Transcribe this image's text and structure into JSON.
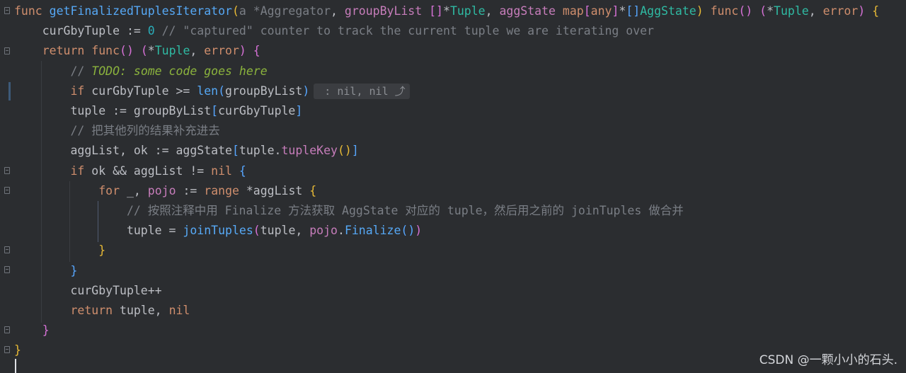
{
  "watermark": "CSDN @一颗小小的石头.",
  "lines": [
    [
      [
        "kw",
        "func "
      ],
      [
        "fn",
        "getFinalizedTuplesIterator"
      ],
      [
        "p1",
        "("
      ],
      [
        "cmt",
        "a *Aggregator"
      ],
      [
        "var",
        ", "
      ],
      [
        "param",
        "groupByList"
      ],
      [
        "var",
        " "
      ],
      [
        "p2",
        "[]"
      ],
      [
        "var",
        "*"
      ],
      [
        "type",
        "Tuple"
      ],
      [
        "var",
        ", "
      ],
      [
        "param",
        "aggState"
      ],
      [
        "var",
        " "
      ],
      [
        "kw",
        "map"
      ],
      [
        "p2",
        "["
      ],
      [
        "kw",
        "any"
      ],
      [
        "p2",
        "]"
      ],
      [
        "var",
        "*"
      ],
      [
        "p3",
        "[]"
      ],
      [
        "type",
        "AggState"
      ],
      [
        "p1",
        ")"
      ],
      [
        "var",
        " "
      ],
      [
        "kw",
        "func"
      ],
      [
        "p2",
        "()"
      ],
      [
        "var",
        " "
      ],
      [
        "p2",
        "("
      ],
      [
        "var",
        "*"
      ],
      [
        "type",
        "Tuple"
      ],
      [
        "var",
        ", "
      ],
      [
        "kw",
        "error"
      ],
      [
        "p2",
        ")"
      ],
      [
        "var",
        " "
      ],
      [
        "p1",
        "{"
      ]
    ],
    [
      [
        "var",
        "    curGbyTuple := "
      ],
      [
        "num",
        "0"
      ],
      [
        "cmt",
        " // \"captured\" counter to track the current tuple we are iterating over"
      ]
    ],
    [
      [
        "kw",
        "    return func"
      ],
      [
        "p2",
        "()"
      ],
      [
        "var",
        " "
      ],
      [
        "p2",
        "("
      ],
      [
        "var",
        "*"
      ],
      [
        "type",
        "Tuple"
      ],
      [
        "var",
        ", "
      ],
      [
        "kw",
        "error"
      ],
      [
        "p2",
        ")"
      ],
      [
        "var",
        " "
      ],
      [
        "p2",
        "{"
      ]
    ],
    [
      [
        "cmt",
        "        // "
      ],
      [
        "todo",
        "TODO: some code goes here"
      ]
    ],
    [
      [
        "kw",
        "        if "
      ],
      [
        "var",
        "curGbyTuple >= "
      ],
      [
        "builtin",
        "len"
      ],
      [
        "p3",
        "("
      ],
      [
        "var",
        "groupByList"
      ],
      [
        "p3",
        ")"
      ],
      [
        "hint",
        " : nil, nil ⤴"
      ]
    ],
    [
      [
        "var",
        "        tuple := groupByList"
      ],
      [
        "p3",
        "["
      ],
      [
        "var",
        "curGbyTuple"
      ],
      [
        "p3",
        "]"
      ]
    ],
    [
      [
        "cmt",
        "        // 把其他列的结果补充进去"
      ]
    ],
    [
      [
        "var",
        "        aggList, ok := aggState"
      ],
      [
        "p3",
        "["
      ],
      [
        "var",
        "tuple."
      ],
      [
        "field",
        "tupleKey"
      ],
      [
        "p1",
        "()"
      ],
      [
        "p3",
        "]"
      ]
    ],
    [
      [
        "kw",
        "        if "
      ],
      [
        "var",
        "ok && aggList != "
      ],
      [
        "kw",
        "nil"
      ],
      [
        "var",
        " "
      ],
      [
        "p3",
        "{"
      ]
    ],
    [
      [
        "kw",
        "            for "
      ],
      [
        "var",
        "_, "
      ],
      [
        "param",
        "pojo"
      ],
      [
        "var",
        " := "
      ],
      [
        "kw",
        "range"
      ],
      [
        "var",
        " *aggList "
      ],
      [
        "p1",
        "{"
      ]
    ],
    [
      [
        "cmt",
        "                // 按照注释中用 Finalize 方法获取 AggState 对应的 tuple，然后用之前的 joinTuples 做合并"
      ]
    ],
    [
      [
        "var",
        "                tuple = "
      ],
      [
        "fncall",
        "joinTuples"
      ],
      [
        "p2",
        "("
      ],
      [
        "var",
        "tuple, "
      ],
      [
        "param",
        "pojo"
      ],
      [
        "var",
        "."
      ],
      [
        "method",
        "Finalize"
      ],
      [
        "p3",
        "()"
      ],
      [
        "p2",
        ")"
      ]
    ],
    [
      [
        "p1",
        "            }"
      ]
    ],
    [
      [
        "p3",
        "        }"
      ]
    ],
    [
      [
        "var",
        "        curGbyTuple++"
      ]
    ],
    [
      [
        "kw",
        "        return "
      ],
      [
        "var",
        "tuple, "
      ],
      [
        "kw",
        "nil"
      ]
    ],
    [
      [
        "p2",
        "    }"
      ]
    ],
    [
      [
        "p1",
        "}"
      ]
    ]
  ]
}
